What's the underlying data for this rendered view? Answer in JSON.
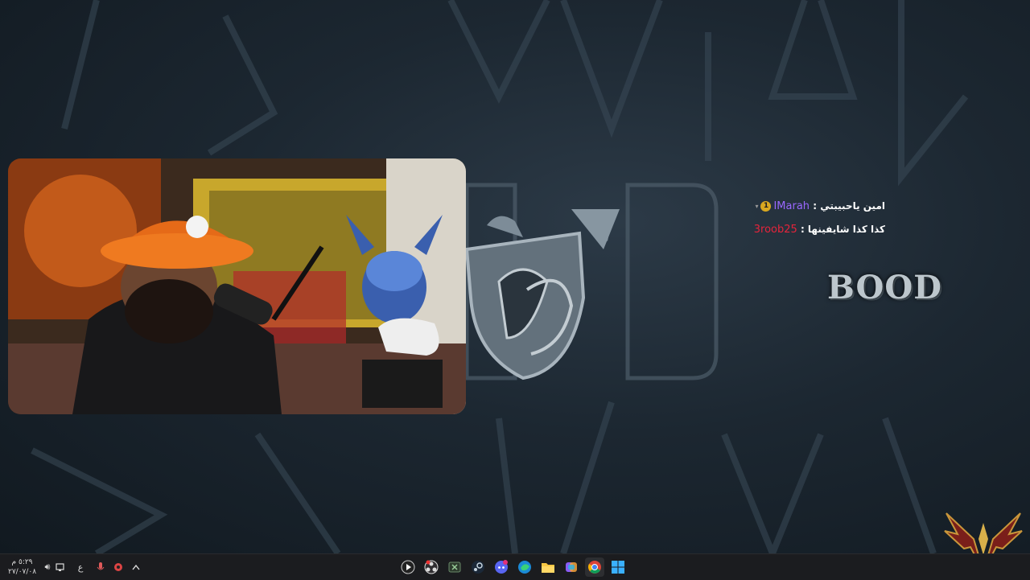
{
  "chat": {
    "messages": [
      {
        "username": "IMarah",
        "separator": " : ",
        "text": "امين ياحبيبتي",
        "badge": "1",
        "user_color": "#9a68ff"
      },
      {
        "username": "3roob25",
        "separator": " : ",
        "text": "كذا كذا شايفينها",
        "user_color": "#e5243b"
      }
    ]
  },
  "overlay": {
    "brand_text": "BOOD"
  },
  "taskbar": {
    "clock_time": "٥:٢٩ م",
    "clock_date": "٢٧/٠٧/٠٨",
    "language": "ع",
    "pinned_apps": [
      "media-player",
      "obs-studio",
      "xbox",
      "steam",
      "discord",
      "edge",
      "file-explorer",
      "copilot",
      "chrome",
      "windows-start"
    ]
  },
  "colors": {
    "taskbar_bg": "#1b1c1f",
    "accent_purple": "#9a68ff",
    "accent_red": "#e5243b"
  }
}
